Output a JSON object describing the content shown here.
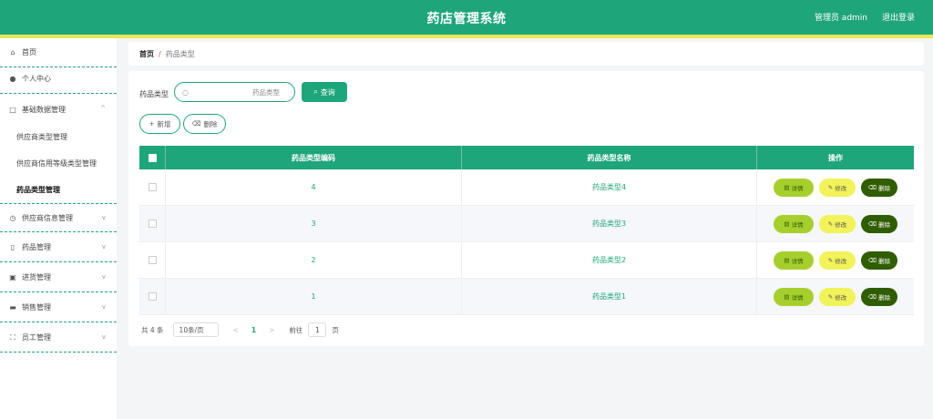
{
  "header": {
    "title": "药店管理系统",
    "user": "管理员 admin",
    "logout": "退出登录"
  },
  "sidebar": {
    "items": [
      {
        "label": "首页",
        "icon": "home-icon"
      },
      {
        "label": "个人中心",
        "icon": "user-icon"
      },
      {
        "label": "基础数据管理",
        "icon": "square-icon"
      },
      {
        "label": "供应商信息管理",
        "icon": "clock-icon"
      },
      {
        "label": "药品管理",
        "icon": "phone-icon"
      },
      {
        "label": "进货管理",
        "icon": "box-icon"
      },
      {
        "label": "销售管理",
        "icon": "cart-icon"
      },
      {
        "label": "员工管理",
        "icon": "expand-icon"
      }
    ],
    "subitems": [
      "供应商类型管理",
      "供应商信用等级类型管理",
      "药品类型管理"
    ]
  },
  "breadcrumb": {
    "home": "首页",
    "separator": "/",
    "current": "药品类型"
  },
  "search": {
    "label": "药品类型",
    "placeholder": "药品类型",
    "button": "查询"
  },
  "actions": {
    "add": "新增",
    "delete": "删除"
  },
  "table": {
    "headers": [
      "药品类型编码",
      "药品类型名称",
      "操作"
    ],
    "rows": [
      {
        "code": "4",
        "name": "药品类型4"
      },
      {
        "code": "3",
        "name": "药品类型3"
      },
      {
        "code": "2",
        "name": "药品类型2"
      },
      {
        "code": "1",
        "name": "药品类型1"
      }
    ],
    "op_labels": {
      "detail": "详情",
      "edit": "修改",
      "delete": "删除"
    }
  },
  "pagination": {
    "total": "共 4 条",
    "page_size": "10条/页",
    "current_page": "1",
    "goto_label": "前往",
    "goto_value": "1",
    "page_suffix": "页"
  },
  "colors": {
    "primary": "#1fa57a",
    "accent_bar": "#e6e85a",
    "detail": "#a6cf2e",
    "edit": "#f2f25a",
    "delete": "#2f5d00"
  }
}
